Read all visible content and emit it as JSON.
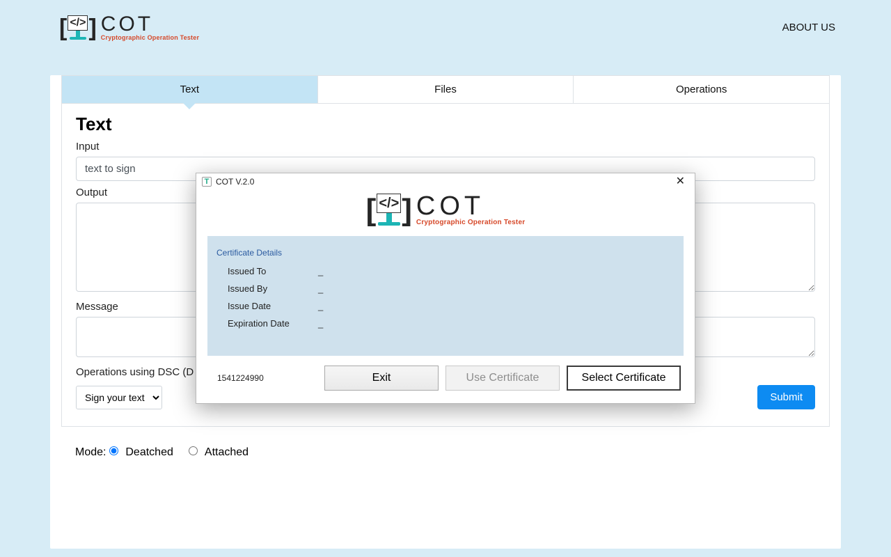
{
  "nav": {
    "about": "ABOUT US"
  },
  "logo": {
    "big": "COT",
    "small": "Cryptographic Operation Tester"
  },
  "tabs": [
    "Text",
    "Files",
    "Operations"
  ],
  "activeTab": 0,
  "heading": "Text",
  "labels": {
    "input": "Input",
    "output": "Output",
    "message": "Message",
    "operations": "Operations using DSC (D"
  },
  "inputValue": "text to sign",
  "selectOptions": [
    "Sign your text"
  ],
  "submit": "Submit",
  "mode": {
    "label": "Mode:",
    "opt1": "Deatched",
    "opt2": "Attached",
    "selected": "Deatched"
  },
  "dialog": {
    "title": "COT V.2.0",
    "certHeader": "Certificate Details",
    "rows": [
      {
        "label": "Issued To",
        "value": "_"
      },
      {
        "label": "Issued By",
        "value": "_"
      },
      {
        "label": "Issue Date",
        "value": "_"
      },
      {
        "label": "Expiration Date",
        "value": "_"
      }
    ],
    "footerNum": "1541224990",
    "btnExit": "Exit",
    "btnUse": "Use Certificate",
    "btnSelect": "Select Certificate"
  }
}
